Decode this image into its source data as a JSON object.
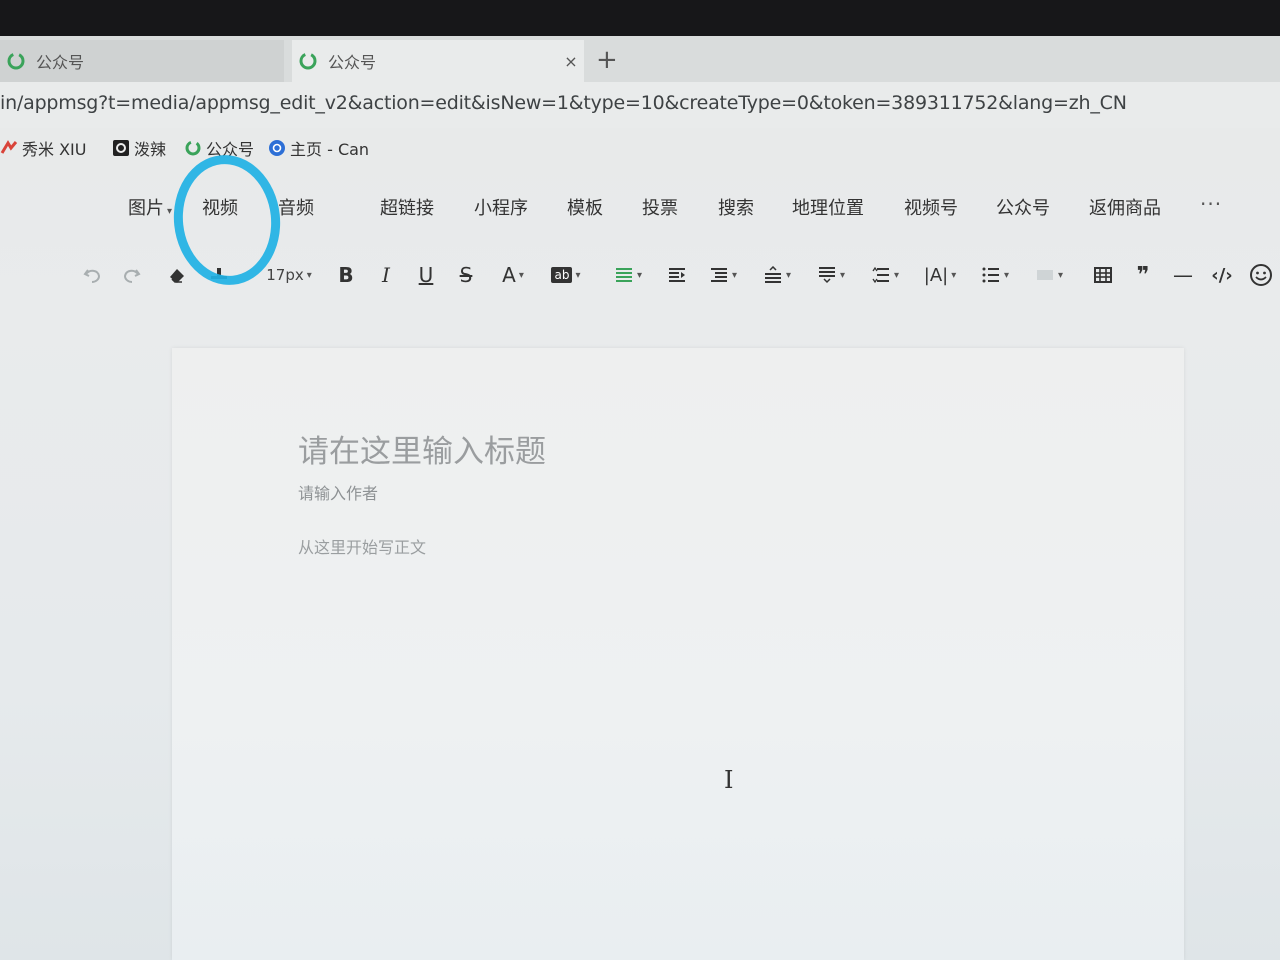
{
  "browser": {
    "tabs": [
      {
        "title": "公众号",
        "active": false
      },
      {
        "title": "公众号",
        "active": true
      }
    ],
    "close_symbol": "×",
    "new_tab_symbol": "+",
    "url": "in/appmsg?t=media/appmsg_edit_v2&action=edit&isNew=1&type=10&createType=0&token=389311752&lang=zh_CN",
    "bookmarks": [
      {
        "label": "秀米 XIU",
        "icon": "xiumi-icon"
      },
      {
        "label": "泼辣",
        "icon": "pola-icon"
      },
      {
        "label": "公众号",
        "icon": "wechat-mp-icon"
      },
      {
        "label": "主页 - Can",
        "icon": "canva-icon"
      }
    ]
  },
  "editor": {
    "insert_menu": [
      "图片",
      "视频",
      "音频",
      "超链接",
      "小程序",
      "模板",
      "投票",
      "搜索",
      "地理位置",
      "视频号",
      "公众号",
      "返佣商品"
    ],
    "more_label": "···",
    "toolbar": {
      "font_size": "17px",
      "bold": "B",
      "italic": "I",
      "underline": "U",
      "strike": "S",
      "font_color": "A",
      "bg_color": "ab",
      "letter_spacing": "|A|",
      "quote": "❞",
      "hr": "—",
      "code": "‹/›"
    },
    "highlighted_item": "视频",
    "highlight_color": "#1fb1e4",
    "accent_green": "#3aa35a",
    "document": {
      "title_placeholder": "请在这里输入标题",
      "author_placeholder": "请输入作者",
      "body_placeholder": "从这里开始写正文"
    },
    "cursor_glyph": "I"
  }
}
